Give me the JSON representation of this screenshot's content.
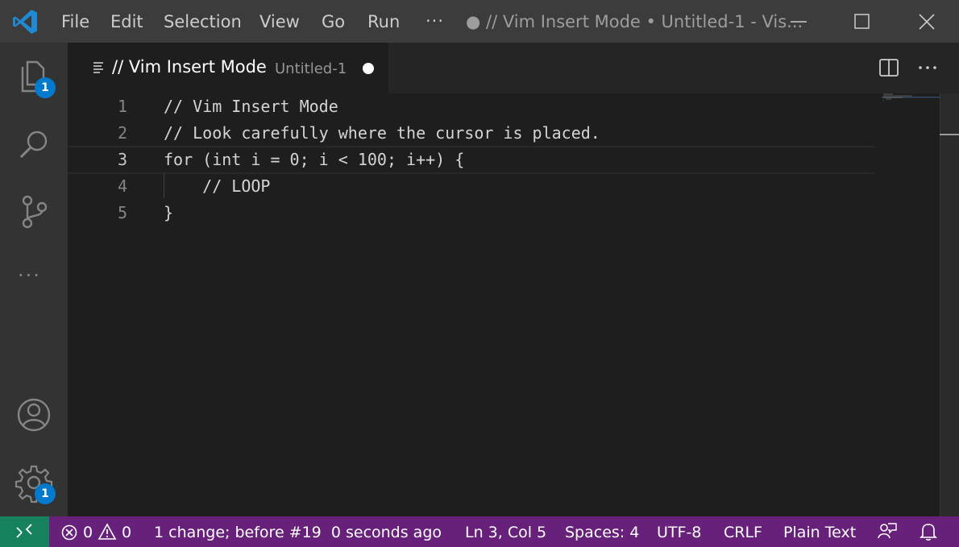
{
  "window": {
    "title": "● // Vim Insert Mode • Untitled-1 - Vis...",
    "menu": [
      "File",
      "Edit",
      "Selection",
      "View",
      "Go",
      "Run"
    ],
    "menu_more": "···"
  },
  "activity_bar": {
    "explorer_badge": "1",
    "settings_badge": "1",
    "more": "···"
  },
  "tab": {
    "title": "// Vim Insert Mode",
    "description": "Untitled-1"
  },
  "editor": {
    "active_line": 3,
    "lines": [
      {
        "number": "1",
        "text": "// Vim Insert Mode"
      },
      {
        "number": "2",
        "text": "// Look carefully where the cursor is placed."
      },
      {
        "number": "3",
        "text": "for (int i = 0; i < 100; i++) {"
      },
      {
        "number": "4",
        "text": "    // LOOP"
      },
      {
        "number": "5",
        "text": "}"
      }
    ]
  },
  "status": {
    "errors": "0",
    "warnings": "0",
    "undo_info": "1 change; before #19  0 seconds ago",
    "position": "Ln 3, Col 5",
    "spaces": "Spaces: 4",
    "encoding": "UTF-8",
    "eol": "CRLF",
    "language": "Plain Text"
  },
  "colors": {
    "status_bar": "#68217a",
    "remote_indicator": "#16825d",
    "badge": "#007acc",
    "accent_logo": "#23a9f2"
  },
  "icons": [
    "vscode-logo",
    "minimize-icon",
    "maximize-icon",
    "close-icon",
    "files-icon",
    "search-icon",
    "source-control-icon",
    "account-icon",
    "gear-icon",
    "split-editor-icon",
    "more-actions-icon",
    "remote-icon",
    "error-icon",
    "warning-icon",
    "feedback-icon",
    "bell-icon"
  ]
}
